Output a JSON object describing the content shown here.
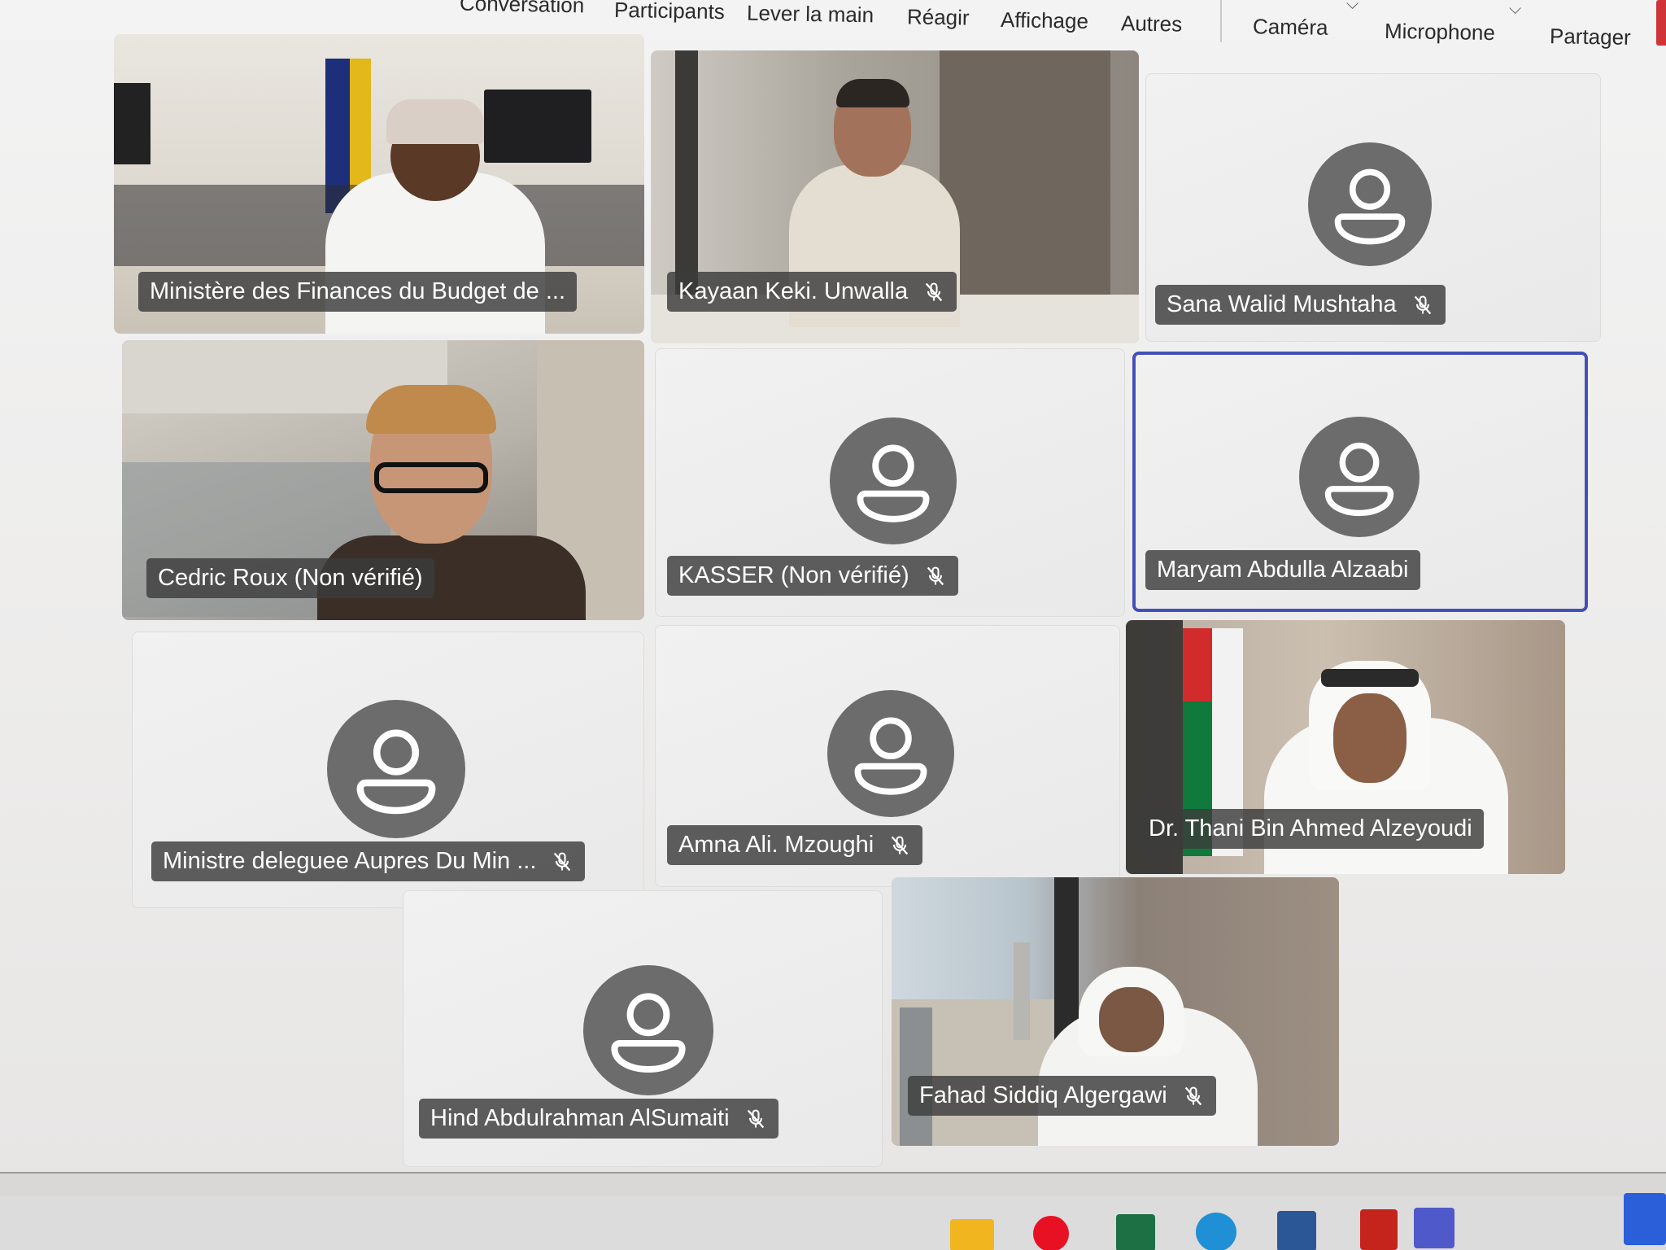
{
  "toolbar": {
    "items": [
      "Conversation",
      "Participants",
      "Lever la main",
      "Réagir",
      "Affichage",
      "Autres",
      "Caméra",
      "Microphone",
      "Partager"
    ]
  },
  "tiles": [
    {
      "name": "Ministère des Finances du Budget de ...",
      "muted": false,
      "video": true,
      "active": false
    },
    {
      "name": "Kayaan Keki. Unwalla",
      "muted": true,
      "video": true,
      "active": false
    },
    {
      "name": "Sana Walid Mushtaha",
      "muted": true,
      "video": false,
      "active": false
    },
    {
      "name": "Cedric Roux (Non vérifié)",
      "muted": false,
      "video": true,
      "active": false
    },
    {
      "name": "KASSER (Non vérifié)",
      "muted": true,
      "video": false,
      "active": false
    },
    {
      "name": "Maryam Abdulla Alzaabi",
      "muted": false,
      "video": false,
      "active": true
    },
    {
      "name": "Ministre deleguee Aupres Du Min ...",
      "muted": true,
      "video": false,
      "active": false
    },
    {
      "name": "Amna Ali. Mzoughi",
      "muted": true,
      "video": false,
      "active": false
    },
    {
      "name": "Dr. Thani Bin Ahmed Alzeyoudi",
      "muted": false,
      "video": true,
      "active": true
    },
    {
      "name": "Hind Abdulrahman AlSumaiti",
      "muted": true,
      "video": false,
      "active": false
    },
    {
      "name": "Fahad Siddiq Algergawi",
      "muted": true,
      "video": true,
      "active": false
    }
  ],
  "colors": {
    "active_border": "#4350b8",
    "avatar": "#6c6c6c",
    "nametag_bg": "#3c3c3c"
  },
  "icons": [
    "mute-icon",
    "person-icon",
    "chevron-down-icon",
    "windows-taskbar-apps"
  ]
}
